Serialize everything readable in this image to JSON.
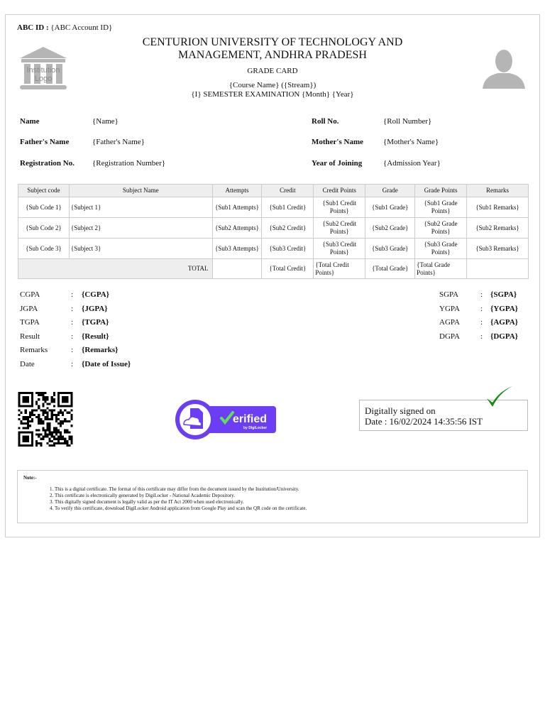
{
  "header": {
    "abc_label": "ABC ID :",
    "abc_value": "{ABC Account ID}",
    "university": "CENTURION UNIVERSITY OF TECHNOLOGY AND MANAGEMENT, ANDHRA PRADESH",
    "doc_title": "GRADE CARD",
    "course": "{Course Name} ({Stream})",
    "exam": "{I} SEMESTER EXAMINATION {Month} {Year}",
    "logo_text": "Institution Logo"
  },
  "student": {
    "name_label": "Name",
    "name": "{Name}",
    "roll_label": "Roll No.",
    "roll": "{Roll Number}",
    "father_label": "Father's Name",
    "father": "{Father's Name}",
    "mother_label": "Mother's Name",
    "mother": "{Mother's Name}",
    "reg_label": "Registration No.",
    "reg": "{Registration Number}",
    "year_label": "Year of Joining",
    "year": "{Admission Year}"
  },
  "table": {
    "headers": [
      "Subject code",
      "Subject Name",
      "Attempts",
      "Credit",
      "Credit Points",
      "Grade",
      "Grade Points",
      "Remarks"
    ],
    "rows": [
      [
        "{Sub Code 1}",
        "{Subject 1}",
        "{Sub1 Attempts}",
        "{Sub1 Credit}",
        "{Sub1 Credit Points}",
        "{Sub1 Grade}",
        "{Sub1 Grade Points}",
        "{Sub1 Remarks}"
      ],
      [
        "{Sub Code 2}",
        "{Subject 2}",
        "{Sub2 Attempts}",
        "{Sub2 Credit}",
        "{Sub2 Credit Points}",
        "{Sub2 Grade}",
        "{Sub2 Grade Points}",
        "{Sub2 Remarks}"
      ],
      [
        "{Sub Code 3}",
        "{Subject 3}",
        "{Sub3 Attempts}",
        "{Sub3 Credit}",
        "{Sub3 Credit Points}",
        "{Sub3 Grade}",
        "{Sub3 Grade Points}",
        "{Sub3 Remarks}"
      ]
    ],
    "total": {
      "label": "TOTAL",
      "credit": "{Total Credit}",
      "credit_points": "{Total Credit Points}",
      "grade": "{Total Grade}",
      "grade_points": "{Total Grade Points}"
    }
  },
  "summary_left": [
    {
      "label": "CGPA",
      "value": "{CGPA}"
    },
    {
      "label": "JGPA",
      "value": "{JGPA}"
    },
    {
      "label": "TGPA",
      "value": "{TGPA}"
    },
    {
      "label": "Result",
      "value": "{Result}"
    },
    {
      "label": "Remarks",
      "value": "{Remarks}"
    },
    {
      "label": "Date",
      "value": "{Date of Issue}"
    }
  ],
  "summary_right": [
    {
      "label": "SGPA",
      "value": "{SGPA}"
    },
    {
      "label": "YGPA",
      "value": "{YGPA}"
    },
    {
      "label": "AGPA",
      "value": "{AGPA}"
    },
    {
      "label": "DGPA",
      "value": "{DGPA}"
    }
  ],
  "colon": ":",
  "badge": {
    "text": "erified",
    "by": "by DigiLocker",
    "color": "#6b3ef5"
  },
  "signature": {
    "line1": "Digitally signed on",
    "line2": "Date : 16/02/2024 14:35:56 IST"
  },
  "note": {
    "title": "Note:-",
    "items": [
      "This is a digital certificate. The format of this certificate may differ from the document issued by the Institution/University.",
      "This certificate is electronically generated by DigiLocker - National Academic Depository.",
      "This digitally signed document is legally valid as per the IT Act 2000 when used electronically.",
      "To verify this certificate, download DigiLocker Android application from Google Play and scan the QR code on the certificate."
    ]
  }
}
